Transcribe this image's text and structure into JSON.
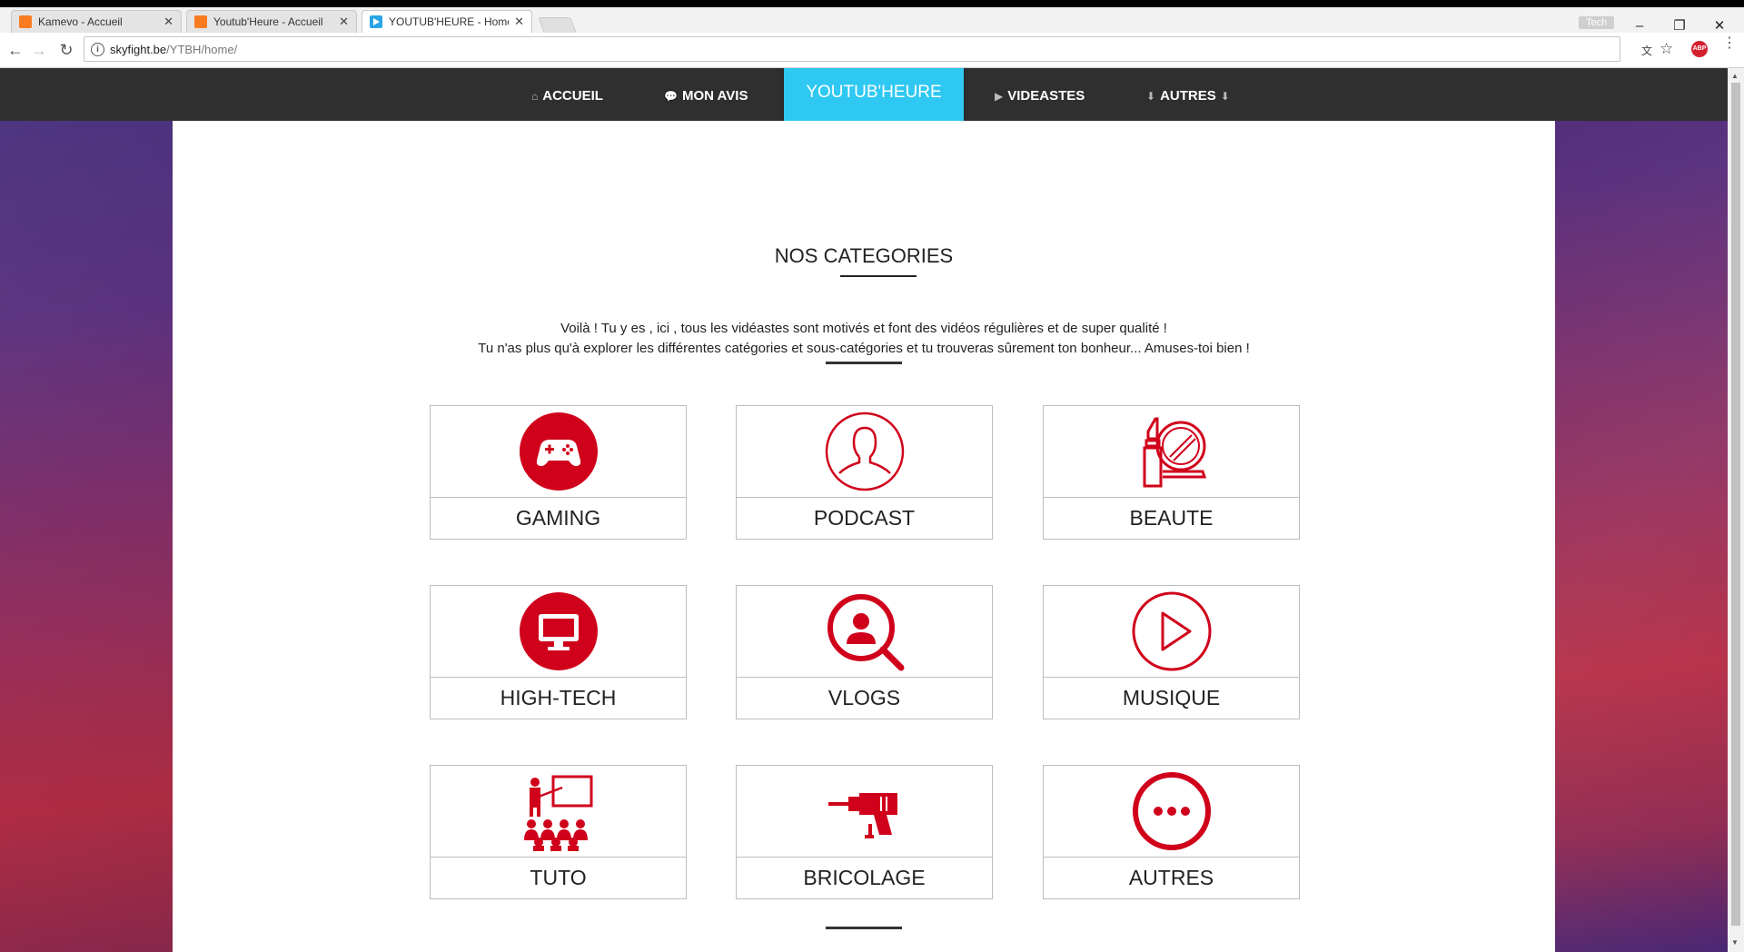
{
  "browser": {
    "tabs": [
      {
        "title": "Kamevo - Accueil",
        "icon": "kamevo-icon"
      },
      {
        "title": "Youtub'Heure - Accueil",
        "icon": "kamevo-icon"
      },
      {
        "title": "YOUTUB'HEURE - Home",
        "icon": "youtube-icon"
      }
    ],
    "profile": "Tech",
    "url_host": "skyfight.be",
    "url_path": "/YTBH/home/"
  },
  "nav": {
    "items": [
      {
        "label": "ACCUEIL",
        "icon": "home-icon"
      },
      {
        "label": "MON AVIS",
        "icon": "comment-icon"
      },
      {
        "label": "YOUTUB'HEURE",
        "active": true
      },
      {
        "label": "VIDEASTES",
        "icon": "play-icon"
      },
      {
        "label": "AUTRES",
        "icon": "arrow-down-icon"
      }
    ]
  },
  "main": {
    "title": "NOS CATEGORIES",
    "intro_line1": "Voilà ! Tu y es , ici , tous les vidéastes sont motivés et font des vidéos régulières et de super qualité !",
    "intro_line2": "Tu n'as plus qu'à explorer les différentes catégories et sous-catégories et tu trouveras sûrement ton bonheur... Amuses-toi bien !",
    "categories": [
      {
        "label": "GAMING",
        "icon": "gamepad-icon"
      },
      {
        "label": "PODCAST",
        "icon": "person-icon"
      },
      {
        "label": "BEAUTE",
        "icon": "lipstick-mirror-icon"
      },
      {
        "label": "HIGH-TECH",
        "icon": "monitor-icon"
      },
      {
        "label": "VLOGS",
        "icon": "user-search-icon"
      },
      {
        "label": "MUSIQUE",
        "icon": "play-circle-icon"
      },
      {
        "label": "TUTO",
        "icon": "teacher-icon"
      },
      {
        "label": "BRICOLAGE",
        "icon": "drill-icon"
      },
      {
        "label": "AUTRES",
        "icon": "more-icon"
      }
    ]
  },
  "colors": {
    "accent": "#d0021b",
    "nav_bg": "#2f2f2f",
    "nav_active": "#2ec8f2"
  }
}
